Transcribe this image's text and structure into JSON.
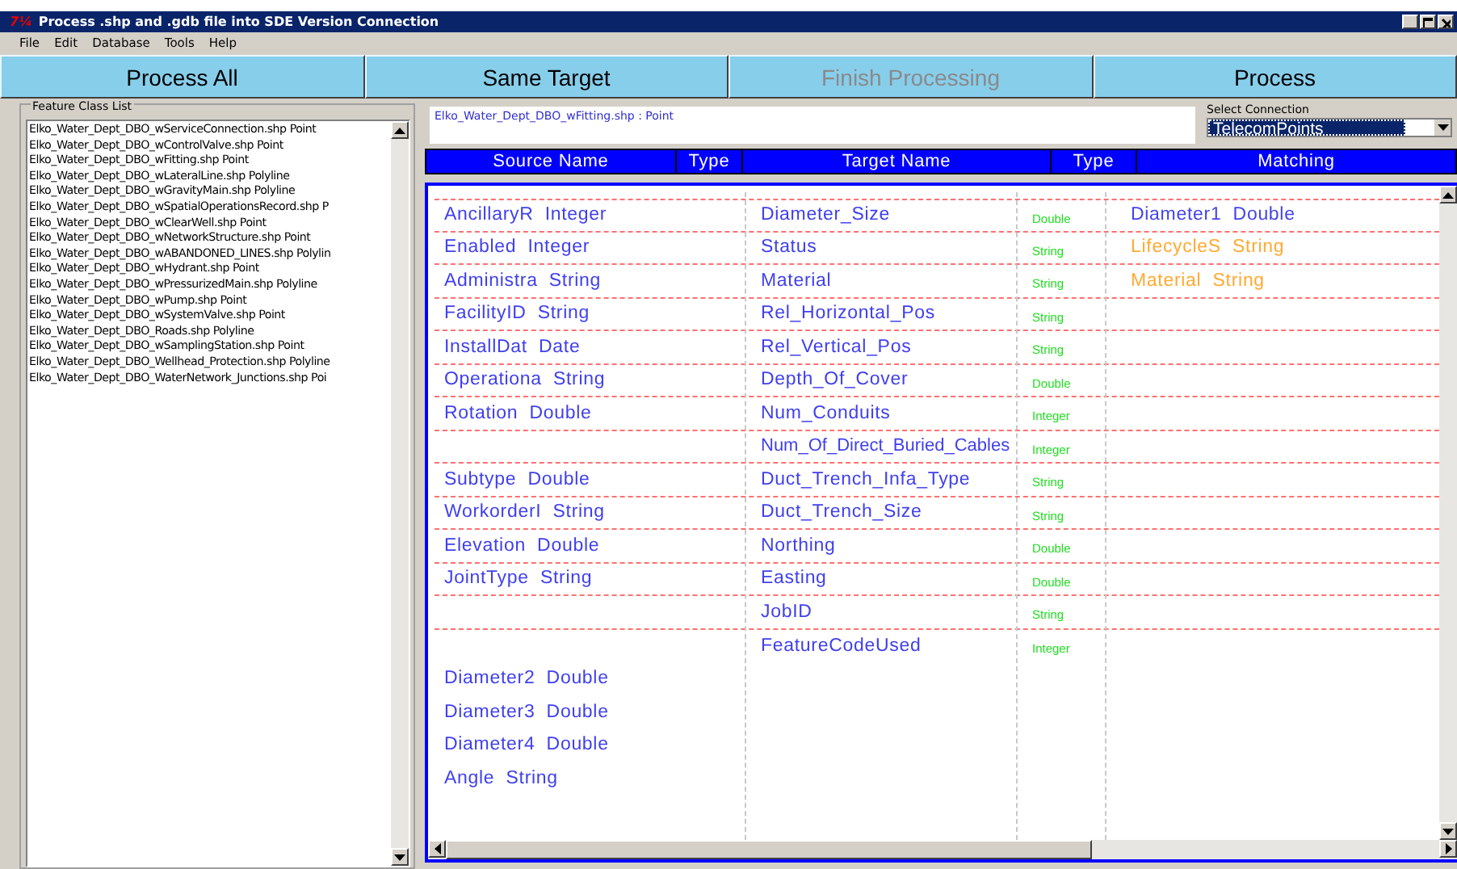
{
  "window": {
    "title": "Process .shp and .gdb file into SDE Version Connection",
    "logo": "7¼"
  },
  "menu": [
    "File",
    "Edit",
    "Database",
    "Tools",
    "Help"
  ],
  "toolbar": [
    {
      "label": "Process All",
      "disabled": false
    },
    {
      "label": "Same Target",
      "disabled": false
    },
    {
      "label": "Finish Processing",
      "disabled": true
    },
    {
      "label": "Process",
      "disabled": false
    }
  ],
  "feature_class_list": {
    "title": "Feature Class List",
    "items": [
      "Elko_Water_Dept_DBO_wServiceConnection.shp Point",
      "Elko_Water_Dept_DBO_wControlValve.shp Point",
      "Elko_Water_Dept_DBO_wFitting.shp Point",
      "Elko_Water_Dept_DBO_wLateralLine.shp Polyline",
      "Elko_Water_Dept_DBO_wGravityMain.shp Polyline",
      "Elko_Water_Dept_DBO_wSpatialOperationsRecord.shp P",
      "Elko_Water_Dept_DBO_wClearWell.shp Point",
      "Elko_Water_Dept_DBO_wNetworkStructure.shp Point",
      "Elko_Water_Dept_DBO_wABANDONED_LINES.shp Polylin",
      "Elko_Water_Dept_DBO_wHydrant.shp Point",
      "Elko_Water_Dept_DBO_wPressurizedMain.shp Polyline",
      "Elko_Water_Dept_DBO_wPump.shp Point",
      "Elko_Water_Dept_DBO_wSystemValve.shp Point",
      "Elko_Water_Dept_DBO_Roads.shp Polyline",
      "Elko_Water_Dept_DBO_wSamplingStation.shp Point",
      "Elko_Water_Dept_DBO_Wellhead_Protection.shp Polyline",
      "Elko_Water_Dept_DBO_WaterNetwork_Junctions.shp Poi"
    ]
  },
  "current_file": "Elko_Water_Dept_DBO_wFitting.shp : Point",
  "select_connection": {
    "label": "Select Connection",
    "value": "TelecomPoints"
  },
  "grid": {
    "columns": [
      "Source Name",
      "Type",
      "Target Name",
      "Type",
      "Matching"
    ],
    "rows": [
      {
        "source": "AncillaryR  Integer",
        "target": "Diameter_Size",
        "type": "Double",
        "match": {
          "text": "Diameter1  Double",
          "color": "#4444ee"
        }
      },
      {
        "source": "Enabled  Integer",
        "target": "Status",
        "type": "String",
        "match": {
          "text": "LifecycleS  String",
          "color": "#ffaa33"
        }
      },
      {
        "source": "Administra  String",
        "target": "Material",
        "type": "String",
        "match": {
          "text": "Material  String",
          "color": "#ffaa33"
        }
      },
      {
        "source": "FacilityID  String",
        "target": "Rel_Horizontal_Pos",
        "type": "String"
      },
      {
        "source": "InstallDat  Date",
        "target": "Rel_Vertical_Pos",
        "type": "String"
      },
      {
        "source": "Operationa  String",
        "target": "Depth_Of_Cover",
        "type": "Double"
      },
      {
        "source": "Rotation  Double",
        "target": "Num_Conduits",
        "type": "Integer"
      },
      {
        "target": "Num_Of_Direct_Buried_Cables",
        "type": "Integer"
      },
      {
        "source": "Subtype  Double",
        "target": "Duct_Trench_Infa_Type",
        "type": "String"
      },
      {
        "source": "WorkorderI  String",
        "target": "Duct_Trench_Size",
        "type": "String"
      },
      {
        "source": "Elevation  Double",
        "target": "Northing",
        "type": "Double"
      },
      {
        "source": "JointType  String",
        "target": "Easting",
        "type": "Double"
      },
      {
        "target": "JobID",
        "type": "String"
      },
      {
        "target": "FeatureCodeUsed",
        "type": "Integer"
      },
      {
        "source": "Diameter2  Double"
      },
      {
        "source": "Diameter3  Double"
      },
      {
        "source": "Diameter4  Double"
      },
      {
        "source": "Angle  String"
      }
    ]
  }
}
